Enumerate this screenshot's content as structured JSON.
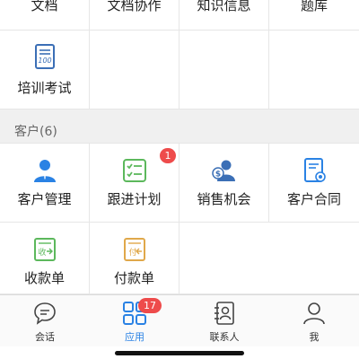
{
  "top_row": {
    "items": [
      {
        "label": "文档"
      },
      {
        "label": "文档协作"
      },
      {
        "label": "知识信息"
      },
      {
        "label": "题库"
      }
    ]
  },
  "training": {
    "label": "培训考试",
    "icon": "exam-paper-icon",
    "icon_text": "100"
  },
  "customer_section": {
    "title": "客户(6)",
    "items": [
      {
        "label": "客户管理",
        "icon": "customer-person-icon"
      },
      {
        "label": "跟进计划",
        "icon": "checklist-icon",
        "badge": "1"
      },
      {
        "label": "销售机会",
        "icon": "sales-opportunity-icon"
      },
      {
        "label": "客户合同",
        "icon": "contract-icon"
      },
      {
        "label": "收款单",
        "icon": "receipt-icon",
        "icon_text": "收"
      },
      {
        "label": "付款单",
        "icon": "payment-icon",
        "icon_text": "付"
      }
    ]
  },
  "tabbar": {
    "tabs": [
      {
        "label": "会话",
        "icon": "chat-bubble-icon"
      },
      {
        "label": "应用",
        "icon": "apps-grid-icon",
        "badge": "17",
        "active": true
      },
      {
        "label": "联系人",
        "icon": "contacts-book-icon"
      },
      {
        "label": "我",
        "icon": "profile-person-icon"
      }
    ]
  },
  "colors": {
    "blue": "#2a82e4",
    "green": "#5cb85c",
    "orange": "#e0a84a",
    "red_badge": "#ee4b4b",
    "section_bg": "#f0f0f0"
  }
}
